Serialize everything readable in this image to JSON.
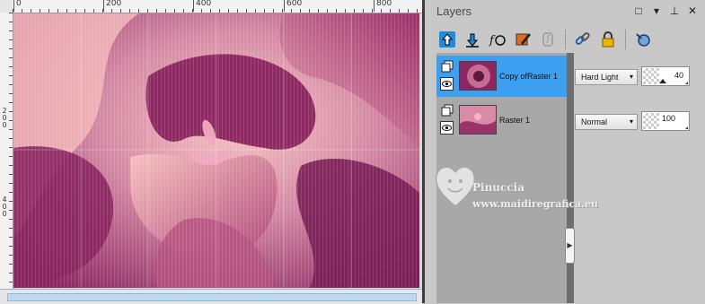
{
  "ruler": {
    "h_ticks": [
      "0",
      "200",
      "400",
      "600",
      "800"
    ],
    "v_ticks": [
      "2\n0\n0",
      "4\n0\n0"
    ]
  },
  "layers_panel": {
    "title": "Layers",
    "controls": [
      "□",
      "▾",
      "⊥",
      "✕"
    ],
    "toolbar_icons": [
      "move-up-icon",
      "move-down-icon",
      "fx-icon",
      "edit-icon",
      "link-icon",
      "chain-icon",
      "lock-icon",
      "refresh-icon"
    ],
    "layers": [
      {
        "name": "Copy ofRaster 1",
        "blend_mode": "Hard Light",
        "opacity": "40",
        "selected": true
      },
      {
        "name": "Raster 1",
        "blend_mode": "Normal",
        "opacity": "100",
        "selected": false
      }
    ]
  },
  "watermark": {
    "name": "Pinuccia",
    "url": "www.maidiregrafica.eu"
  },
  "colors": {
    "accent": "#3d9ff0",
    "canvas_magenta": "#8a2660",
    "canvas_pink": "#f2b6b8"
  }
}
